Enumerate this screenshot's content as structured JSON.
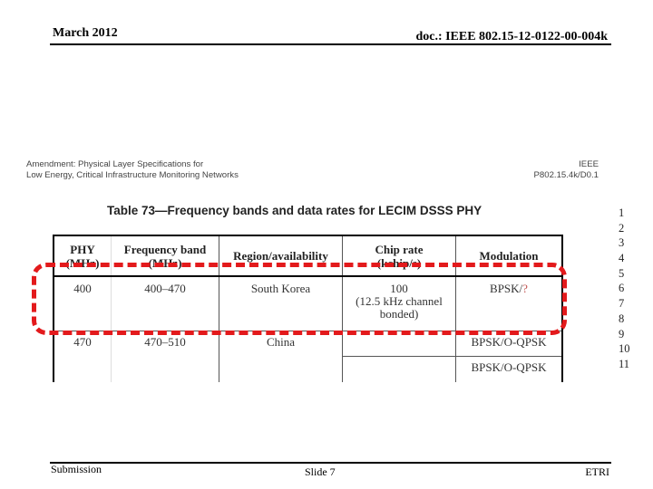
{
  "header": {
    "date": "March 2012",
    "doc_id": "doc.: IEEE 802.15-12-0122-00-004k"
  },
  "footer": {
    "left": "Submission",
    "center": "Slide 7",
    "right": "ETRI"
  },
  "document": {
    "amendment_line1": "Amendment: Physical Layer Specifications for",
    "amendment_line2": "Low Energy, Critical Infrastructure Monitoring Networks",
    "ieee_line1": "IEEE",
    "ieee_line2": "P802.15.4k/D0.1",
    "table_caption": "Table 73—Frequency bands and data rates for LECIM DSSS PHY",
    "table": {
      "headers": [
        {
          "line1": "PHY",
          "line2": "(MHz)"
        },
        {
          "line1": "Frequency band",
          "line2": "(MHz)"
        },
        {
          "line1": "Region/availability",
          "line2": ""
        },
        {
          "line1": "Chip rate",
          "line2": "(kchip/s)"
        },
        {
          "line1": "Modulation",
          "line2": ""
        }
      ],
      "rows": [
        {
          "phy": "400",
          "band": "400–470",
          "region": "South Korea",
          "chip_rate_line1": "100",
          "chip_rate_line2": "(12.5 kHz channel",
          "chip_rate_line3": "bonded)",
          "modulation": "BPSK/",
          "modulation_suffix": "?"
        },
        {
          "phy": "470",
          "band": "470–510",
          "region": "China",
          "chip_rate": "",
          "modulation": "BPSK/O-QPSK",
          "chip_rate_b": "",
          "modulation_b": "BPSK/O-QPSK"
        }
      ]
    },
    "line_numbers": [
      "1",
      "2",
      "3",
      "4",
      "5",
      "6",
      "7",
      "8",
      "9",
      "10",
      "11"
    ]
  },
  "annotation": {
    "highlight_color": "#e31a1c",
    "style": "dashed-rounded-rectangle"
  }
}
